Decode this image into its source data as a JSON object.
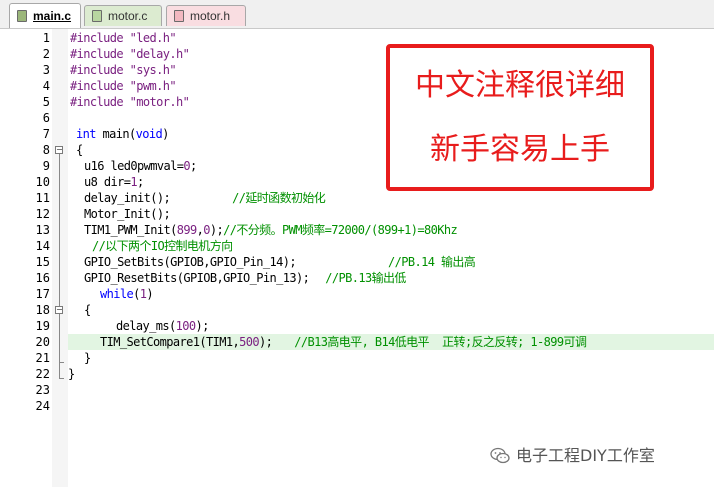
{
  "tabs": [
    {
      "label": "main.c",
      "active": true,
      "color": "#9bb67a"
    },
    {
      "label": "motor.c",
      "active": false,
      "color": "#b8d5a0"
    },
    {
      "label": "motor.h",
      "active": false,
      "color": "#f2b8c0"
    }
  ],
  "line_numbers": [
    "1",
    "2",
    "3",
    "4",
    "5",
    "6",
    "7",
    "8",
    "9",
    "10",
    "11",
    "12",
    "13",
    "14",
    "15",
    "16",
    "17",
    "18",
    "19",
    "20",
    "21",
    "22",
    "23",
    "24"
  ],
  "code": {
    "l1": {
      "directive": "#include",
      "arg": "\"led.h\""
    },
    "l2": {
      "directive": "#include",
      "arg": "\"delay.h\""
    },
    "l3": {
      "directive": "#include",
      "arg": "\"sys.h\""
    },
    "l4": {
      "directive": "#include",
      "arg": "\"pwm.h\""
    },
    "l5": {
      "directive": "#include",
      "arg": "\"motor.h\""
    },
    "l7": {
      "kw1": "int",
      "mid": " main(",
      "kw2": "void",
      "end": ")"
    },
    "l8": {
      "text": "{"
    },
    "l9": {
      "pre": "u16 led0pwmval=",
      "num": "0",
      "post": ";"
    },
    "l10": {
      "pre": "u8 dir=",
      "num": "1",
      "post": ";"
    },
    "l11": {
      "pre": "delay_init();",
      "comment": "//延时函数初始化"
    },
    "l12": {
      "text": "Motor_Init();"
    },
    "l13": {
      "pre": "TIM1_PWM_Init(",
      "num1": "899",
      "sep": ",",
      "num2": "0",
      "post": ");",
      "comment": "//不分频。PWM频率=72000/(899+1)=80Khz"
    },
    "l14": {
      "comment": "//以下两个IO控制电机方向"
    },
    "l15": {
      "pre": "GPIO_SetBits(GPIOB,GPIO_Pin_14);",
      "comment": "//PB.14 输出高"
    },
    "l16": {
      "pre": "GPIO_ResetBits(GPIOB,GPIO_Pin_13);",
      "comment": "//PB.13输出低"
    },
    "l17": {
      "kw": "while",
      "open": "(",
      "num": "1",
      "close": ")"
    },
    "l18": {
      "text": "{"
    },
    "l19": {
      "pre": "delay_ms(",
      "num": "100",
      "post": ");"
    },
    "l20": {
      "pre": "TIM_SetCompare1(TIM1,",
      "num": "500",
      "post": ");",
      "comment": "//B13高电平, B14低电平  正转;反之反转; 1-899可调"
    },
    "l21": {
      "text": "}"
    },
    "l22": {
      "text": "}"
    }
  },
  "annotation": {
    "line1": "中文注释很详细",
    "line2": "新手容易上手",
    "color": "#e81c1c"
  },
  "watermark": {
    "text": "电子工程DIY工作室",
    "icon": "wechat-icon"
  }
}
